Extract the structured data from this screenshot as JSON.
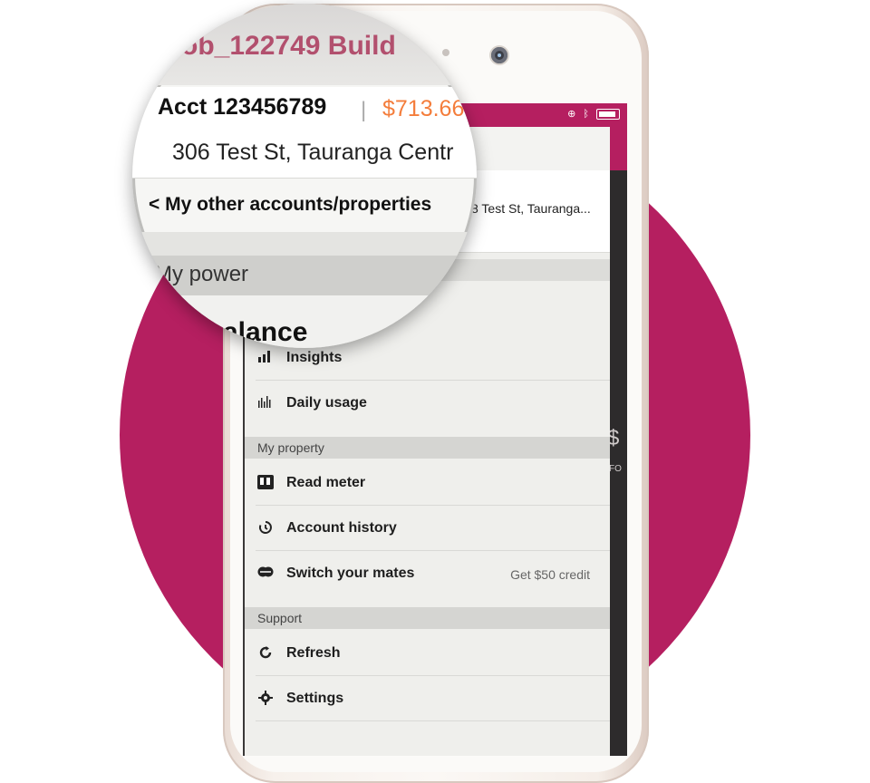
{
  "colors": {
    "brand": "#b51f60",
    "accent_orange": "#f47d3b",
    "drawer_bg": "#efefec"
  },
  "magnifier": {
    "title_fragment": "ob_122749 Build",
    "account_label": "Acct 123456789",
    "separator": "|",
    "balance": "$713.66",
    "address": "306 Test St, Tauranga Centr",
    "other_accounts": "< My other accounts/properties",
    "section_label": "My power",
    "balance_label_fragment": "alance"
  },
  "drawer": {
    "title_fragment": "49",
    "address_truncated": "8 Test St, Tauranga..."
  },
  "background_fragments": {
    "dollar": "$",
    "text": "FO"
  },
  "menu": {
    "power_items": [
      {
        "icon": "bar-chart-icon",
        "label": "Insights"
      },
      {
        "icon": "daily-usage-icon",
        "label": "Daily usage"
      }
    ],
    "property_section": "My property",
    "property_items": [
      {
        "icon": "meter-icon",
        "label": "Read meter"
      },
      {
        "icon": "history-icon",
        "label": "Account history"
      },
      {
        "icon": "switch-icon",
        "label": "Switch your mates",
        "right": "Get $50 credit"
      }
    ],
    "support_section": "Support",
    "support_items": [
      {
        "icon": "refresh-icon",
        "label": "Refresh"
      },
      {
        "icon": "settings-icon",
        "label": "Settings"
      }
    ]
  }
}
